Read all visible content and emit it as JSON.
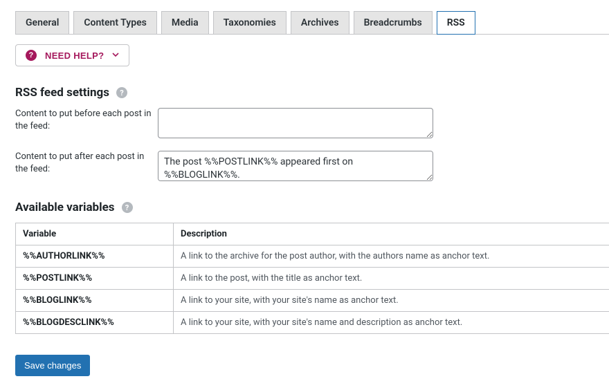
{
  "tabs": {
    "items": [
      {
        "label": "General",
        "active": false
      },
      {
        "label": "Content Types",
        "active": false
      },
      {
        "label": "Media",
        "active": false
      },
      {
        "label": "Taxonomies",
        "active": false
      },
      {
        "label": "Archives",
        "active": false
      },
      {
        "label": "Breadcrumbs",
        "active": false
      },
      {
        "label": "RSS",
        "active": true
      }
    ]
  },
  "help_button": {
    "label": "NEED HELP?"
  },
  "sections": {
    "rss": {
      "heading": "RSS feed settings",
      "before_label": "Content to put before each post in the feed:",
      "before_value": "",
      "after_label": "Content to put after each post in the feed:",
      "after_value": "The post %%POSTLINK%% appeared first on %%BLOGLINK%%."
    },
    "vars": {
      "heading": "Available variables",
      "columns": {
        "variable": "Variable",
        "description": "Description"
      },
      "rows": [
        {
          "var": "%%AUTHORLINK%%",
          "desc": "A link to the archive for the post author, with the authors name as anchor text."
        },
        {
          "var": "%%POSTLINK%%",
          "desc": "A link to the post, with the title as anchor text."
        },
        {
          "var": "%%BLOGLINK%%",
          "desc": "A link to your site, with your site's name as anchor text."
        },
        {
          "var": "%%BLOGDESCLINK%%",
          "desc": "A link to your site, with your site's name and description as anchor text."
        }
      ]
    }
  },
  "buttons": {
    "save": "Save changes"
  }
}
